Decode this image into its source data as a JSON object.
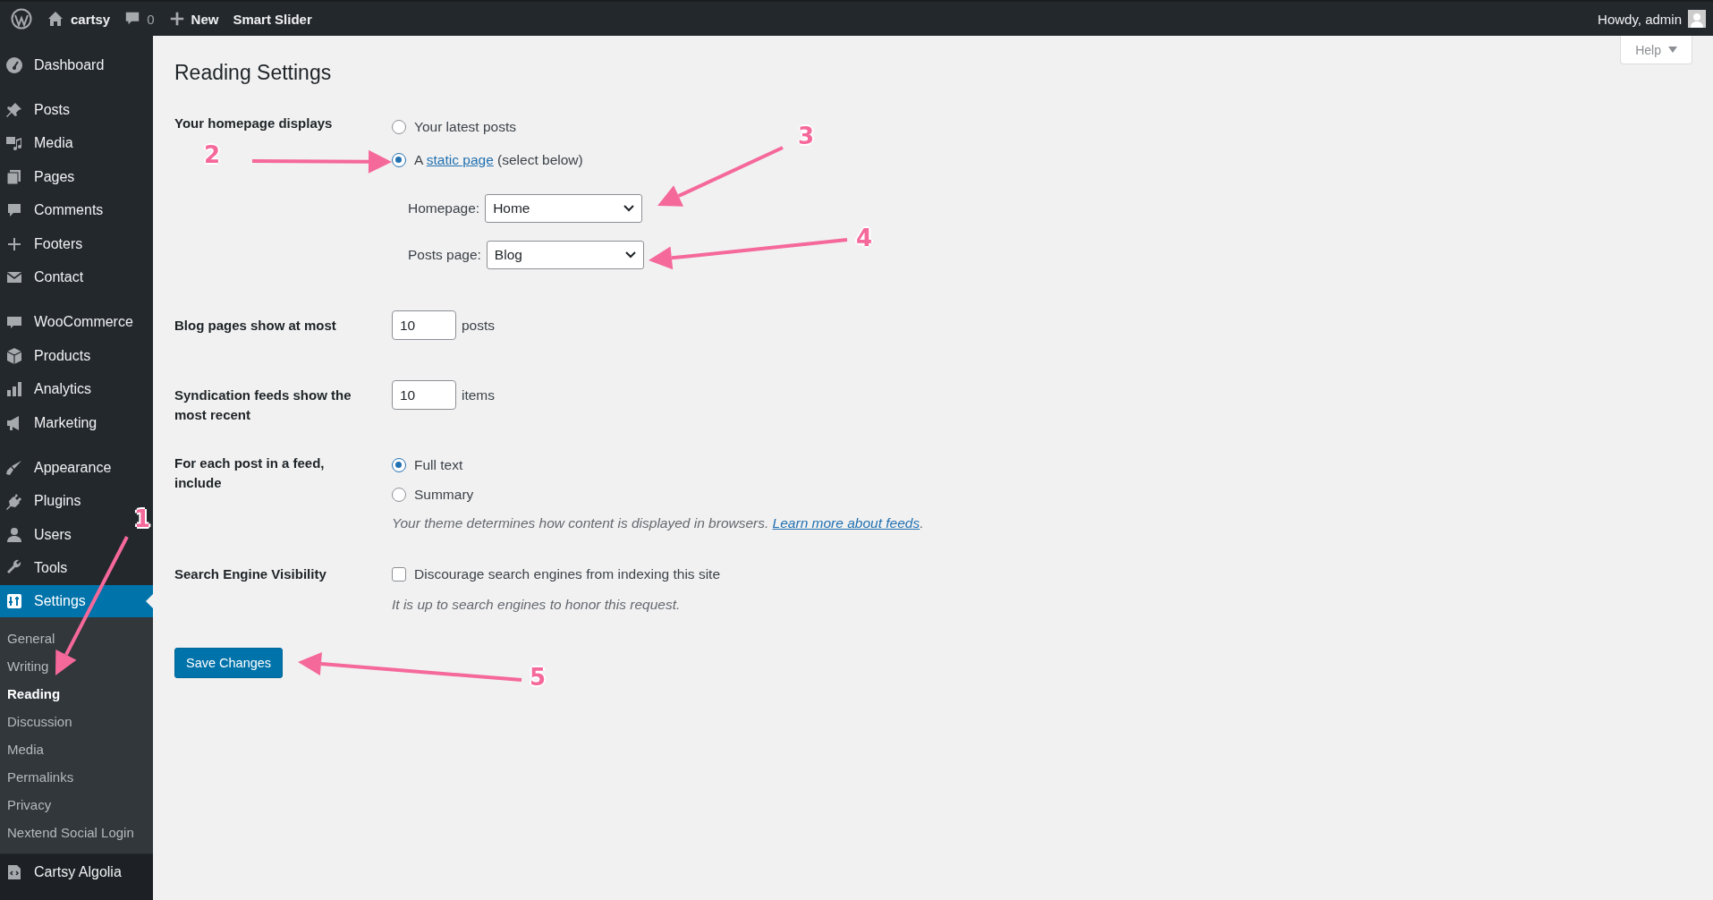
{
  "admin_bar": {
    "site_name": "cartsy",
    "comments_count": "0",
    "new_label": "New",
    "plugin_item": "Smart Slider",
    "greeting": "Howdy, admin"
  },
  "sidebar": {
    "groups": [
      {
        "items": [
          {
            "label": "Dashboard",
            "selected": false
          }
        ]
      },
      {
        "items": [
          {
            "label": "Posts",
            "selected": false
          },
          {
            "label": "Media",
            "selected": false
          },
          {
            "label": "Pages",
            "selected": false
          },
          {
            "label": "Comments",
            "selected": false
          },
          {
            "label": "Footers",
            "selected": false
          },
          {
            "label": "Contact",
            "selected": false
          }
        ]
      },
      {
        "items": [
          {
            "label": "WooCommerce",
            "selected": false
          },
          {
            "label": "Products",
            "selected": false
          },
          {
            "label": "Analytics",
            "selected": false
          },
          {
            "label": "Marketing",
            "selected": false
          }
        ]
      },
      {
        "items": [
          {
            "label": "Appearance",
            "selected": false
          },
          {
            "label": "Plugins",
            "selected": false
          },
          {
            "label": "Users",
            "selected": false
          },
          {
            "label": "Tools",
            "selected": false
          },
          {
            "label": "Settings",
            "selected": true,
            "children": [
              {
                "label": "General",
                "selected": false
              },
              {
                "label": "Writing",
                "selected": false
              },
              {
                "label": "Reading",
                "selected": true
              },
              {
                "label": "Discussion",
                "selected": false
              },
              {
                "label": "Media",
                "selected": false
              },
              {
                "label": "Permalinks",
                "selected": false
              },
              {
                "label": "Privacy",
                "selected": false
              },
              {
                "label": "Nextend Social Login",
                "selected": false
              }
            ]
          }
        ]
      },
      {
        "items": [
          {
            "label": "Cartsy Algolia",
            "selected": false
          }
        ]
      }
    ]
  },
  "page": {
    "title": "Reading Settings",
    "help_tab": "Help",
    "settings": [
      {
        "kind": "radio_group",
        "label": "Your homepage displays",
        "options": [
          {
            "text": "Your latest posts",
            "selected": false
          },
          {
            "before": "A",
            "link": "static page",
            "after": "(select below)",
            "selected": true
          }
        ],
        "selects": [
          {
            "label": "Homepage:",
            "value": "Home"
          },
          {
            "label": "Posts page:",
            "value": "Blog"
          }
        ]
      },
      {
        "kind": "number",
        "label": "Blog pages show at most",
        "value": "10",
        "unit": "posts"
      },
      {
        "kind": "number",
        "label": "Syndication feeds show the most recent",
        "value": "10",
        "unit": "items"
      },
      {
        "kind": "radio_group",
        "label": "For each post in a feed, include",
        "options": [
          {
            "text": "Full text",
            "selected": true
          },
          {
            "text": "Summary",
            "selected": false
          }
        ],
        "description": {
          "before": "Your theme determines how content is displayed in browsers.",
          "link": "Learn more about feeds",
          "after": "."
        }
      },
      {
        "kind": "checkbox",
        "label": "Search Engine Visibility",
        "option": "Discourage search engines from indexing this site",
        "checked": false,
        "description": {
          "before": "It is up to search engines to honor this request."
        }
      }
    ],
    "save_button": "Save Changes"
  },
  "annotations": [
    {
      "number": "1"
    },
    {
      "number": "2"
    },
    {
      "number": "3"
    },
    {
      "number": "4"
    },
    {
      "number": "5"
    }
  ]
}
